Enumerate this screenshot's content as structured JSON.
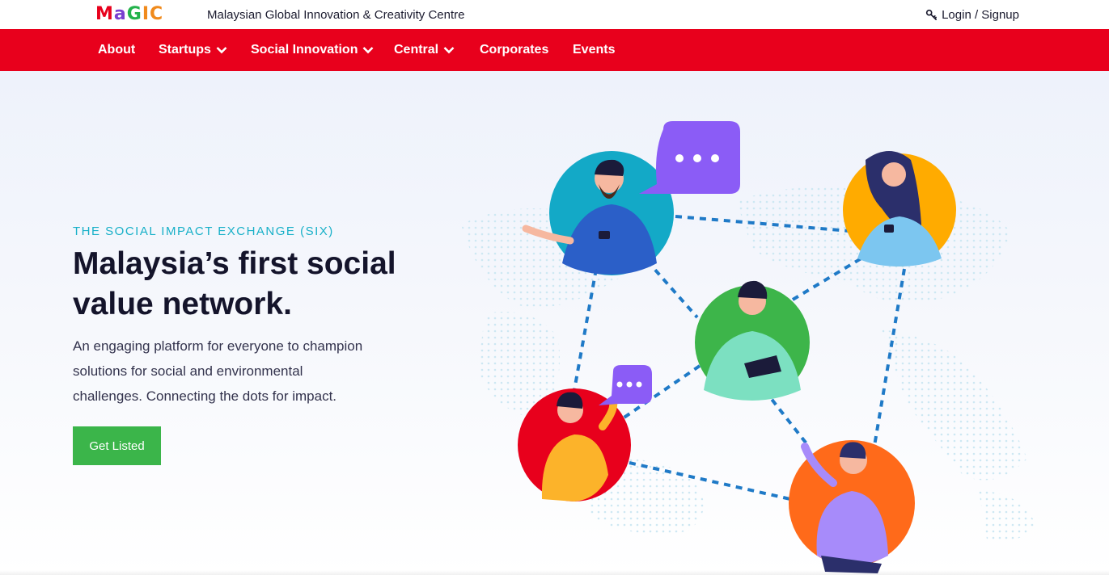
{
  "header": {
    "logo_letters": [
      "M",
      "a",
      "G",
      "I",
      "C"
    ],
    "logo_colors": [
      "#e8001c",
      "#7a3fd0",
      "#23b24b",
      "#f08a1c",
      "#f08a1c"
    ],
    "org_name": "Malaysian Global Innovation & Creativity Centre",
    "login_label": "Login / Signup",
    "login_icon": "key-icon"
  },
  "nav": {
    "background": "#e8001c",
    "items": [
      {
        "label": "About",
        "has_dropdown": false
      },
      {
        "label": "Startups",
        "has_dropdown": true
      },
      {
        "label": "Social Innovation",
        "has_dropdown": true
      },
      {
        "label": "Central",
        "has_dropdown": true
      },
      {
        "label": "Corporates",
        "has_dropdown": false
      },
      {
        "label": "Events",
        "has_dropdown": false
      }
    ]
  },
  "hero": {
    "eyebrow": "THE SOCIAL IMPACT EXCHANGE (SIX)",
    "headline_line1": "Malaysia’s first social",
    "headline_line2": "value network.",
    "description_line1": "An engaging platform for everyone to champion",
    "description_line2": "solutions for social and environmental",
    "description_line3": "challenges. Connecting the dots for impact.",
    "cta_label": "Get Listed",
    "cta_color": "#3bb54a",
    "eyebrow_color": "#17b0c8"
  },
  "illustration": {
    "description_icon": "social-network-illustration",
    "avatar_colors": [
      "#13a9c7",
      "#ffab00",
      "#3db54a",
      "#e8001c",
      "#ff6a1a"
    ],
    "chat_bubble_color": "#8b5cf6",
    "connector_color": "#1f7ac7"
  }
}
